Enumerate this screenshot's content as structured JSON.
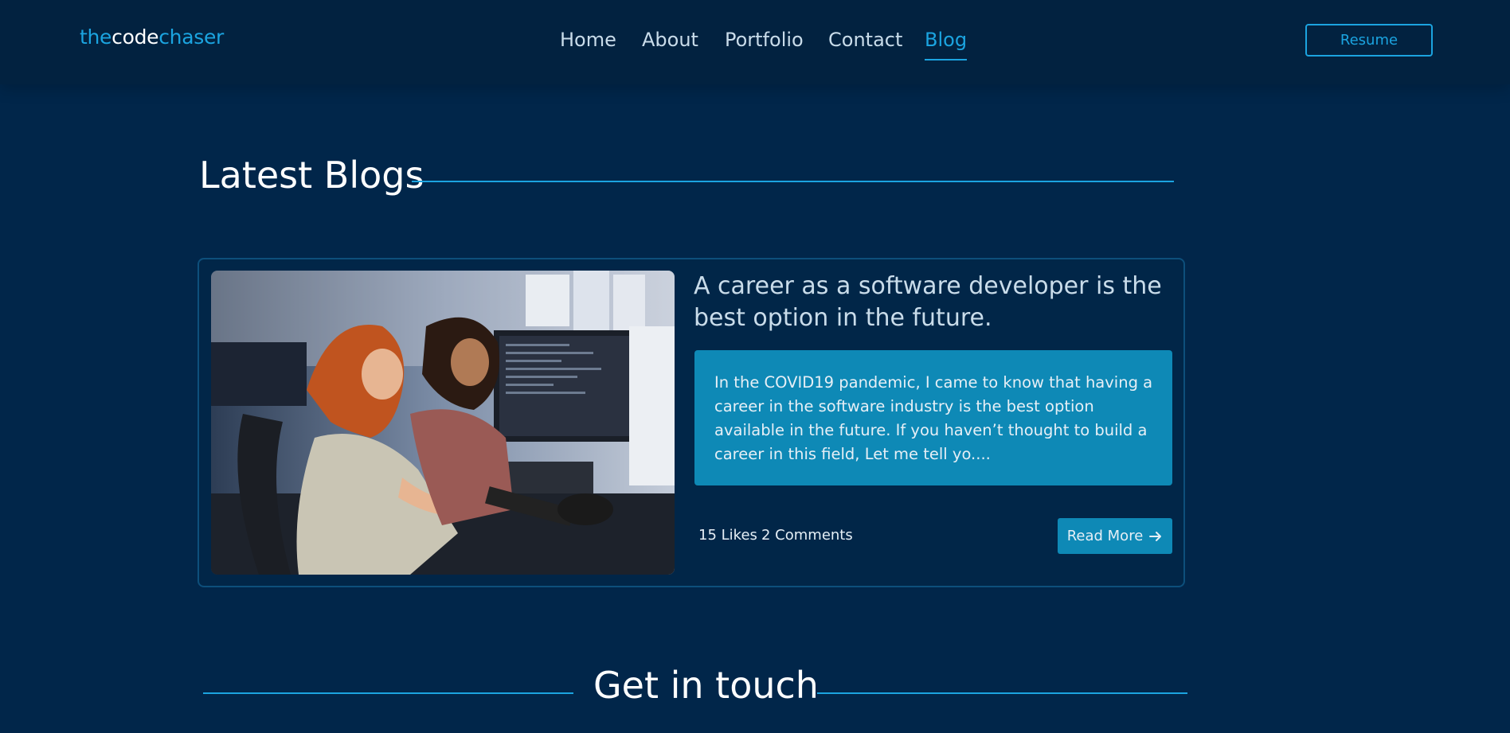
{
  "logo": {
    "part1": "the",
    "part2": "code",
    "part3": "chaser"
  },
  "nav": {
    "items": [
      {
        "label": "Home"
      },
      {
        "label": "About"
      },
      {
        "label": "Portfolio"
      },
      {
        "label": "Contact"
      },
      {
        "label": "Blog",
        "active": true
      }
    ],
    "resume_label": "Resume"
  },
  "latest_blogs": {
    "heading": "Latest Blogs",
    "posts": [
      {
        "title": "A career as a software developer is the best option in the future.",
        "excerpt": "In the COVID19 pandemic, I came to know that having a career in the software industry is the best option available in the future. If you haven’t thought to build a career in this field, Let me tell yo....",
        "likes": "15 Likes",
        "comments": "2 Comments",
        "read_more_label": "Read More",
        "read_more_icon": "arrow-right-icon",
        "image_icon": "developers-at-workstation-photo"
      }
    ]
  },
  "contact": {
    "heading": "Get in touch"
  },
  "colors": {
    "background": "#01264a",
    "navbar": "#022240",
    "accent": "#1ba4e0",
    "excerpt_box": "#0e89b6"
  }
}
